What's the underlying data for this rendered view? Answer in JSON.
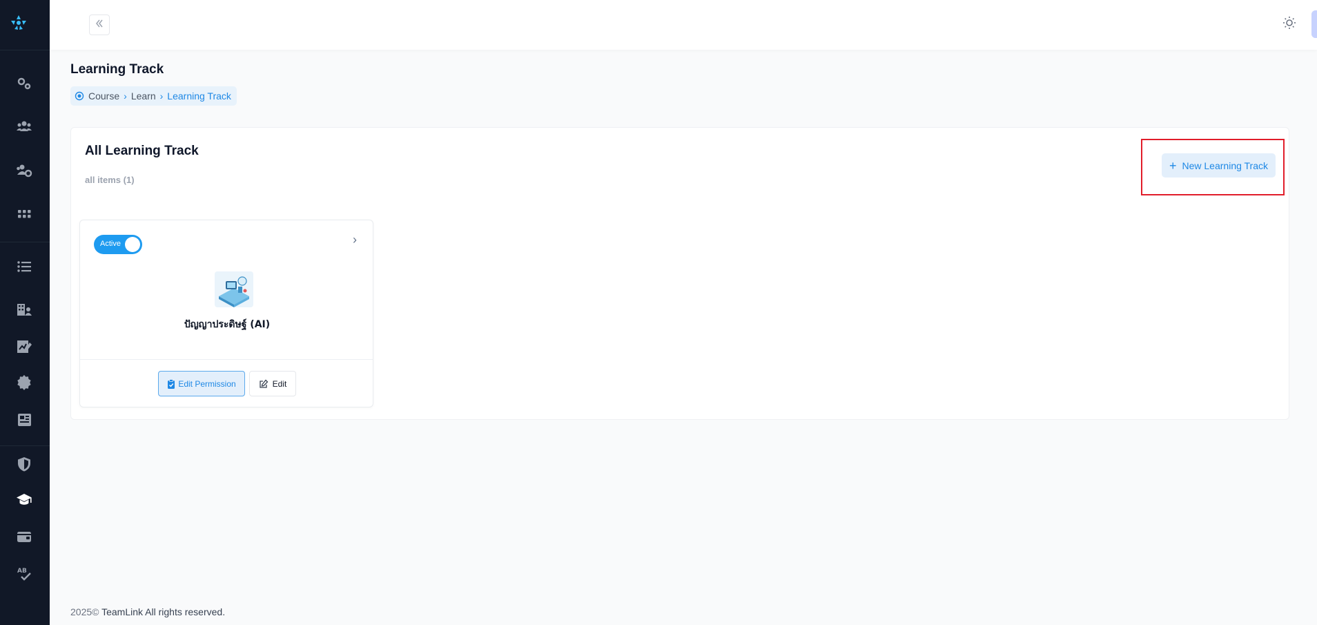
{
  "sidebar": {
    "icons": [
      "settings-gears-icon",
      "users-group-icon",
      "users-settings-icon",
      "apps-grid-icon",
      "list-icon",
      "building-user-icon",
      "chart-edit-icon",
      "badge-gear-icon",
      "newspaper-icon",
      "shield-icon",
      "graduation-cap-icon",
      "wallet-icon",
      "spell-check-icon"
    ],
    "active": "graduation-cap-icon",
    "colors": {
      "background": "#111827",
      "icon": "#9ca3af",
      "active_icon": "#ffffff"
    }
  },
  "header": {
    "page_title": "Learning Track",
    "breadcrumb": [
      "Course",
      "Learn",
      "Learning Track"
    ]
  },
  "panel": {
    "title": "All Learning Track",
    "subtitle": "all items (1)",
    "new_button_label": "New Learning Track"
  },
  "cards": [
    {
      "status": "Active",
      "enabled": true,
      "name": "ปัญญาประดิษฐ์ (AI)",
      "permission_button": "Edit Permission",
      "edit_button": "Edit"
    }
  ],
  "footer": {
    "year": "2025©",
    "brand": "TeamLink",
    "rights": "All rights reserved."
  },
  "colors": {
    "accent": "#1e88e5",
    "toggle": "#1e9bf0",
    "highlight": "#e11d2a"
  }
}
